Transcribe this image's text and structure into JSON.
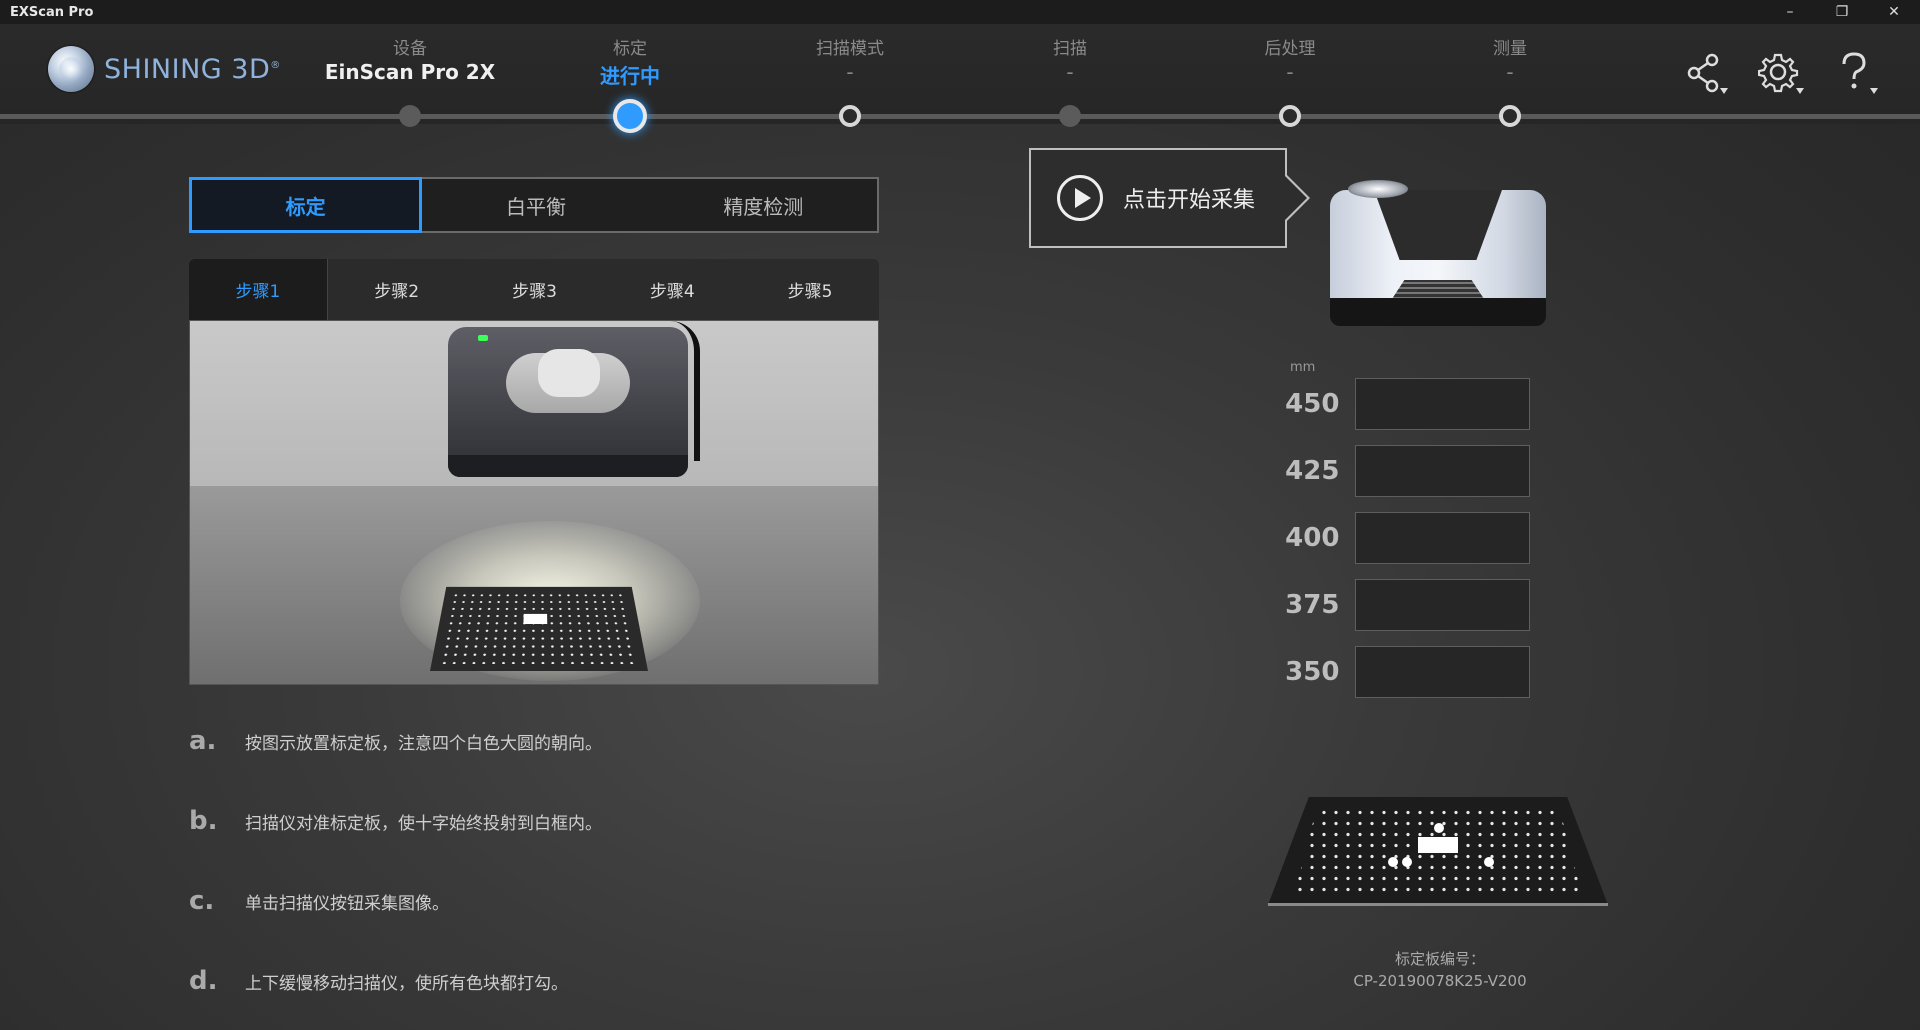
{
  "window": {
    "title": "EXScan Pro",
    "controls": {
      "minimize": "–",
      "restore": "❐",
      "close": "✕"
    }
  },
  "brand": {
    "name": "SHINING 3D",
    "mark": "®"
  },
  "steps": [
    {
      "label": "设备",
      "value": "EinScan Pro 2X",
      "state": "done"
    },
    {
      "label": "标定",
      "value": "进行中",
      "state": "active"
    },
    {
      "label": "扫描模式",
      "value": "-",
      "state": "pending"
    },
    {
      "label": "扫描",
      "value": "-",
      "state": "done"
    },
    {
      "label": "后处理",
      "value": "-",
      "state": "pending"
    },
    {
      "label": "测量",
      "value": "-",
      "state": "pending"
    }
  ],
  "header_icons": [
    "share-icon",
    "gear-icon",
    "help-icon"
  ],
  "main_tabs": [
    "标定",
    "白平衡",
    "精度检测"
  ],
  "sub_tabs": [
    "步骤1",
    "步骤2",
    "步骤3",
    "步骤4",
    "步骤5"
  ],
  "instructions": [
    {
      "letter": "a.",
      "text": "按图示放置标定板，注意四个白色大圆的朝向。"
    },
    {
      "letter": "b.",
      "text": "扫描仪对准标定板，使十字始终投射到白框内。"
    },
    {
      "letter": "c.",
      "text": "单击扫描仪按钮采集图像。"
    },
    {
      "letter": "d.",
      "text": "上下缓慢移动扫描仪，使所有色块都打勾。"
    }
  ],
  "start_button": {
    "label": "点击开始采集"
  },
  "distance": {
    "unit": "mm",
    "values": [
      "450",
      "425",
      "400",
      "375",
      "350"
    ]
  },
  "board": {
    "label": "标定板编号：",
    "code": "CP-20190078K25-V200"
  },
  "colors": {
    "accent": "#2f9bff",
    "background": "#333333"
  }
}
